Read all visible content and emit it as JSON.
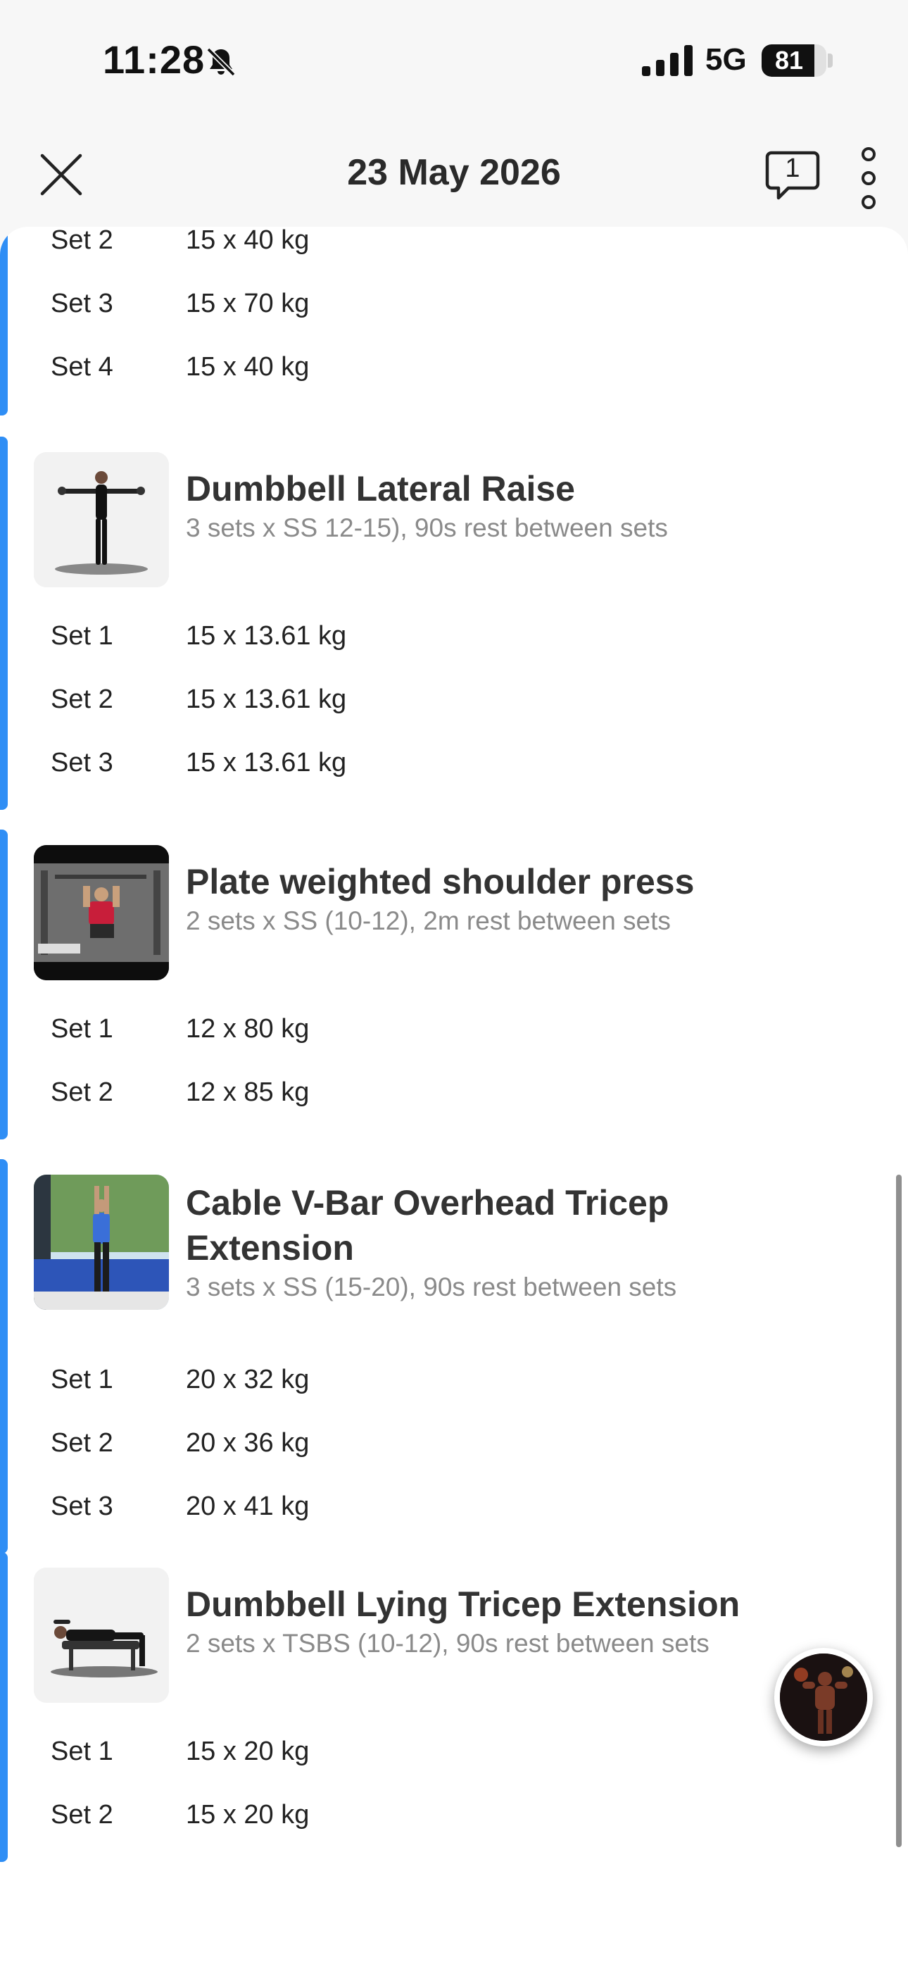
{
  "status": {
    "time": "11:28",
    "network": "5G",
    "battery": "81",
    "battery_level": 0.81
  },
  "nav": {
    "title": "23 May 2026",
    "comment_count": "1"
  },
  "top_partial": {
    "sets": [
      {
        "label": "Set 2",
        "value": "15 x 40 kg"
      },
      {
        "label": "Set 3",
        "value": "15 x 70 kg"
      },
      {
        "label": "Set 4",
        "value": "15 x 40 kg"
      }
    ]
  },
  "exercises": [
    {
      "name": "Dumbbell Lateral Raise",
      "description": "3 sets x SS 12-15), 90s rest between sets",
      "sets": [
        {
          "label": "Set 1",
          "value": "15 x 13.61 kg"
        },
        {
          "label": "Set 2",
          "value": "15 x 13.61 kg"
        },
        {
          "label": "Set 3",
          "value": "15 x 13.61 kg"
        }
      ]
    },
    {
      "name": "Plate weighted shoulder press",
      "description": "2 sets x SS (10-12), 2m rest between sets",
      "sets": [
        {
          "label": "Set 1",
          "value": "12 x 80 kg"
        },
        {
          "label": "Set 2",
          "value": "12 x 85 kg"
        }
      ]
    },
    {
      "name": "Cable V-Bar Overhead Tricep Extension",
      "description": "3 sets x SS (15-20), 90s rest between sets",
      "sets": [
        {
          "label": "Set 1",
          "value": "20 x 32 kg"
        },
        {
          "label": "Set 2",
          "value": "20 x 36 kg"
        },
        {
          "label": "Set 3",
          "value": "20 x 41 kg"
        }
      ]
    },
    {
      "name": "Dumbbell Lying Tricep Extension",
      "description": "2 sets x TSBS (10-12), 90s rest between sets",
      "sets": [
        {
          "label": "Set 1",
          "value": "15 x 20 kg"
        },
        {
          "label": "Set 2",
          "value": "15 x 20 kg"
        }
      ]
    }
  ],
  "colors": {
    "accent": "#2f8ef5",
    "muted_text": "#8a8a8a"
  }
}
